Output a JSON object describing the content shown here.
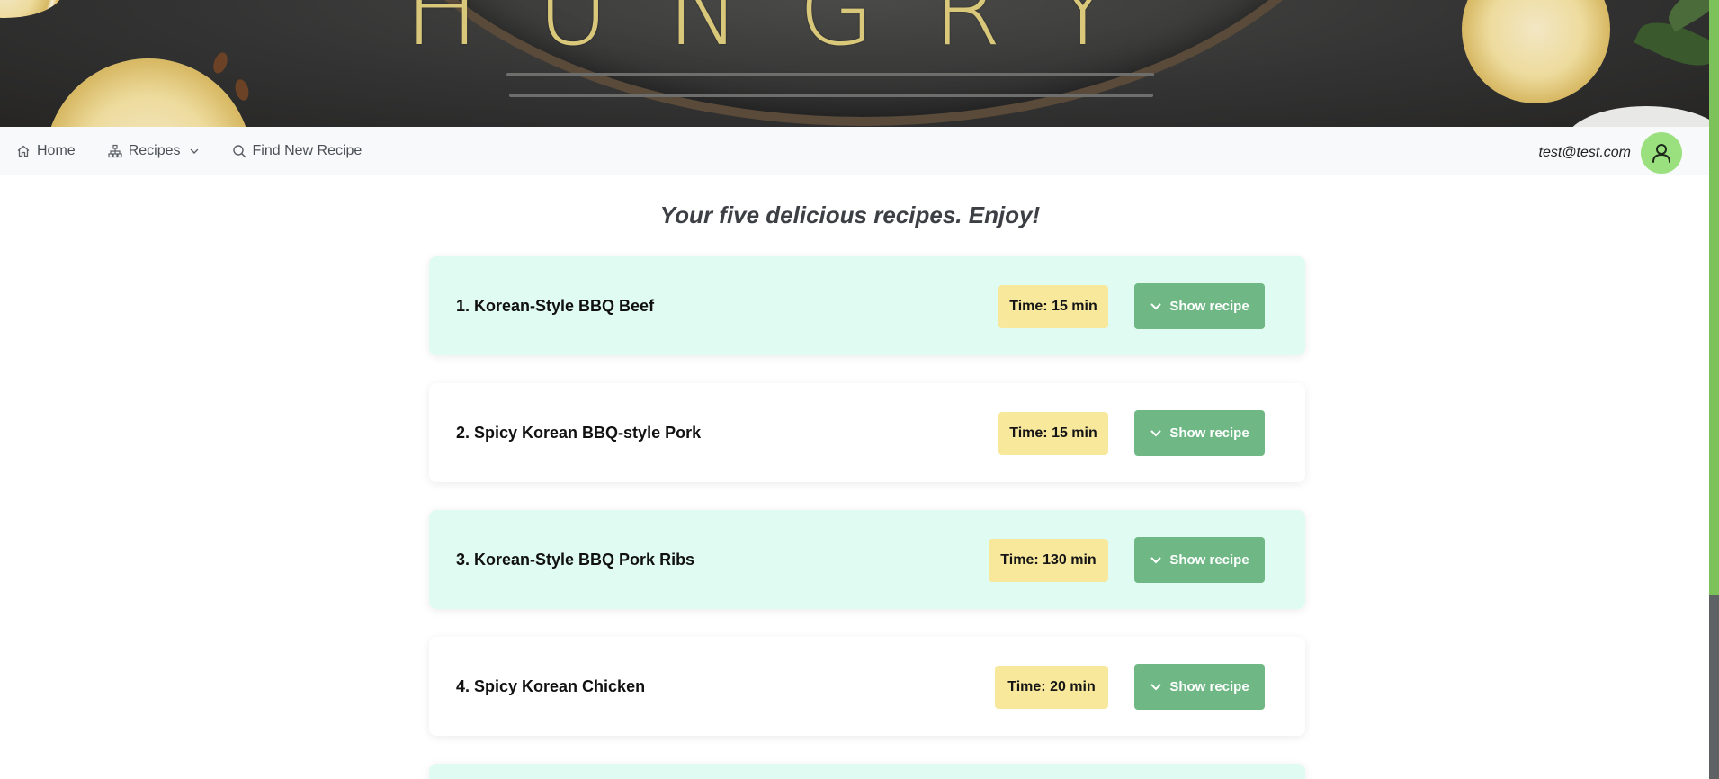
{
  "nav": {
    "home_label": "Home",
    "recipes_label": "Recipes",
    "find_label": "Find New Recipe",
    "user_email": "test@test.com"
  },
  "page": {
    "title": "Your five delicious recipes. Enjoy!"
  },
  "recipes": [
    {
      "title": "1. Korean-Style BBQ Beef",
      "time": "Time: 15 min",
      "button": "Show recipe"
    },
    {
      "title": "2. Spicy Korean BBQ-style Pork",
      "time": "Time: 15 min",
      "button": "Show recipe"
    },
    {
      "title": "3. Korean-Style BBQ Pork Ribs",
      "time": "Time: 130 min",
      "button": "Show recipe"
    },
    {
      "title": "4. Spicy Korean Chicken",
      "time": "Time: 20 min",
      "button": "Show recipe"
    }
  ],
  "colors": {
    "mint_card": "#e0fbf1",
    "time_badge": "#f8e89c",
    "button": "#6fb886",
    "avatar": "#9be07e"
  },
  "icons": [
    "home-icon",
    "sitemap-icon",
    "chevron-down-icon",
    "search-icon",
    "user-icon"
  ]
}
